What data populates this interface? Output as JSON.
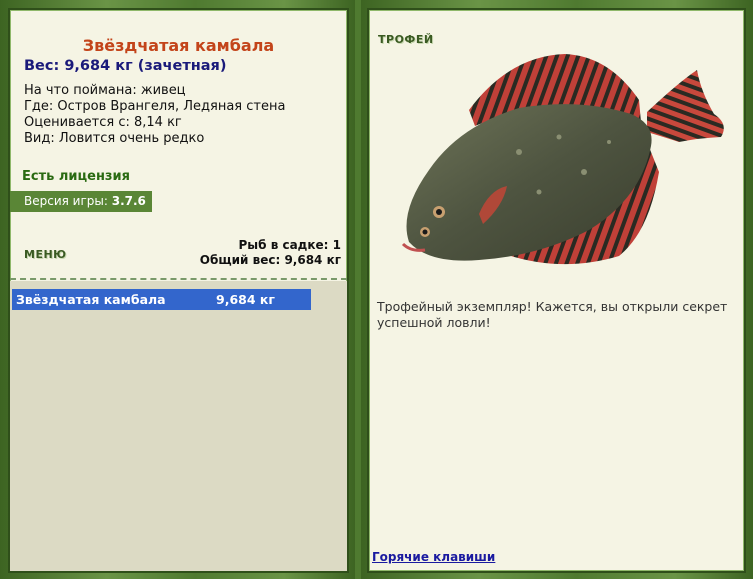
{
  "left": {
    "fish_name": "Звёздчатая камбала",
    "weight_line": "Вес: 9,684 кг (зачетная)",
    "info": [
      "На что поймана: живец",
      "Где: Остров Врангеля, Ледяная стена",
      "Оценивается с: 8,14 кг",
      "Вид: Ловится очень редко"
    ],
    "license": "Есть лицензия",
    "version_label": "Версия игры:",
    "version_value": "3.7.6",
    "menu_label": "МЕНЮ",
    "keep_count": "Рыб в садке: 1",
    "keep_total": "Общий вес: 9,684 кг",
    "keep_list": [
      {
        "name": "Звёздчатая камбала",
        "weight": "9,684 кг"
      }
    ]
  },
  "right": {
    "trophy_label": "ТРОФЕЙ",
    "trophy_text": "Трофейный экземпляр! Кажется, вы открыли секрет успешной ловли!",
    "hotkeys_link": "Горячие клавиши",
    "fish_image": "starry-flounder-icon"
  },
  "colors": {
    "title": "#c3441a",
    "weight": "#1a1a7a",
    "license": "#2a6a12",
    "selection": "#3366cc",
    "panel_bg": "#f5f4e4",
    "frame_green": "#4f7a30"
  }
}
